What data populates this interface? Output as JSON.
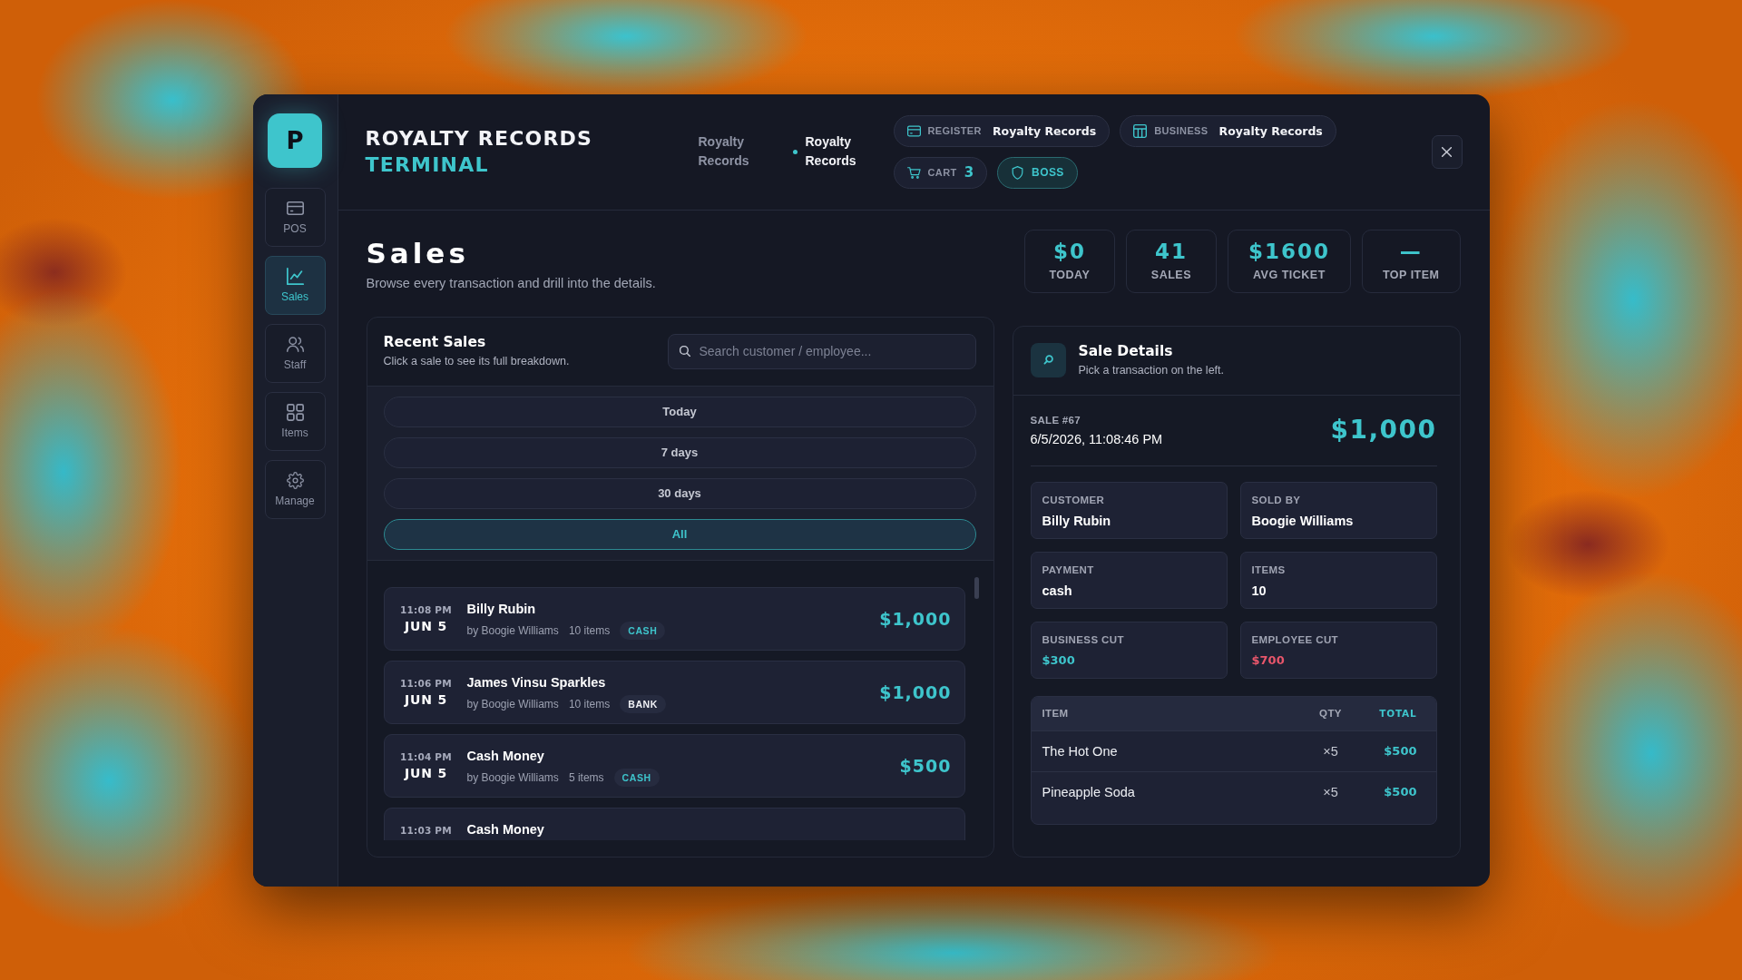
{
  "app": {
    "logo": "P",
    "title": "ROYALTY RECORDS",
    "subtitle": "TERMINAL"
  },
  "sidebar": {
    "items": [
      {
        "label": "POS",
        "selected": false
      },
      {
        "label": "Sales",
        "selected": true
      },
      {
        "label": "Staff",
        "selected": false
      },
      {
        "label": "Items",
        "selected": false
      },
      {
        "label": "Manage",
        "selected": false
      }
    ]
  },
  "header": {
    "crumbs": [
      {
        "label": "Royalty Records",
        "selected": false
      },
      {
        "label": "Royalty Records",
        "selected": true
      }
    ],
    "chips": [
      {
        "kind": "register",
        "label": "REGISTER",
        "value": "Royalty Records"
      },
      {
        "kind": "business",
        "label": "BUSINESS",
        "value": "Royalty Records"
      },
      {
        "kind": "cart",
        "label": "CART",
        "value": "3"
      },
      {
        "kind": "role",
        "label": "BOSS"
      }
    ]
  },
  "page": {
    "title": "Sales",
    "subtitle": "Browse every transaction and drill into the details."
  },
  "stats": [
    {
      "value": "$0",
      "label": "TODAY"
    },
    {
      "value": "41",
      "label": "SALES"
    },
    {
      "value": "$1600",
      "label": "AVG TICKET"
    },
    {
      "value": "—",
      "label": "TOP ITEM"
    }
  ],
  "recent_sales": {
    "title": "Recent Sales",
    "subtitle": "Click a sale to see its full breakdown.",
    "search": {
      "placeholder": "Search customer / employee..."
    },
    "filters": [
      {
        "label": "Today",
        "selected": false
      },
      {
        "label": "7 days",
        "selected": false
      },
      {
        "label": "30 days",
        "selected": false
      },
      {
        "label": "All",
        "selected": true
      }
    ],
    "sales": [
      {
        "time": "11:08 PM",
        "date": "JUN 5",
        "customer": "Billy Rubin",
        "seller": "by Boogie Williams",
        "items": "10 items",
        "payment": {
          "label": "CASH",
          "kind": "cash"
        },
        "amount": "$1,000"
      },
      {
        "time": "11:06 PM",
        "date": "JUN 5",
        "customer": "James Vinsu Sparkles",
        "seller": "by Boogie Williams",
        "items": "10 items",
        "payment": {
          "label": "BANK",
          "kind": "bank"
        },
        "amount": "$1,000"
      },
      {
        "time": "11:04 PM",
        "date": "JUN 5",
        "customer": "Cash Money",
        "seller": "by Boogie Williams",
        "items": "5 items",
        "payment": {
          "label": "CASH",
          "kind": "cash"
        },
        "amount": "$500"
      },
      {
        "time": "11:03 PM",
        "customer": "Cash Money"
      }
    ]
  },
  "sale_details": {
    "title": "Sale Details",
    "subtitle": "Pick a transaction on the left.",
    "sale_label": "SALE #67",
    "datetime": "6/5/2026, 11:08:46 PM",
    "total": "$1,000",
    "fields": [
      {
        "label": "CUSTOMER",
        "value": "Billy Rubin",
        "kind": "text",
        "color": "#ffffff"
      },
      {
        "label": "SOLD BY",
        "value": "Boogie Williams",
        "kind": "text",
        "color": "#ffffff"
      },
      {
        "label": "PAYMENT",
        "value": "cash",
        "kind": "text",
        "color": "#ffffff"
      },
      {
        "label": "ITEMS",
        "value": "10",
        "kind": "text",
        "color": "#ffffff"
      },
      {
        "label": "BUSINESS CUT",
        "value": "$300",
        "kind": "money",
        "color": "#3ec5cc"
      },
      {
        "label": "EMPLOYEE CUT",
        "value": "$700",
        "kind": "money",
        "color": "#e8566b"
      }
    ],
    "table": {
      "columns": [
        "ITEM",
        "QTY",
        "TOTAL"
      ],
      "rows": [
        [
          "The Hot One",
          "×5",
          "$500"
        ],
        [
          "Pineapple Soda",
          "×5",
          "$500"
        ]
      ]
    }
  }
}
